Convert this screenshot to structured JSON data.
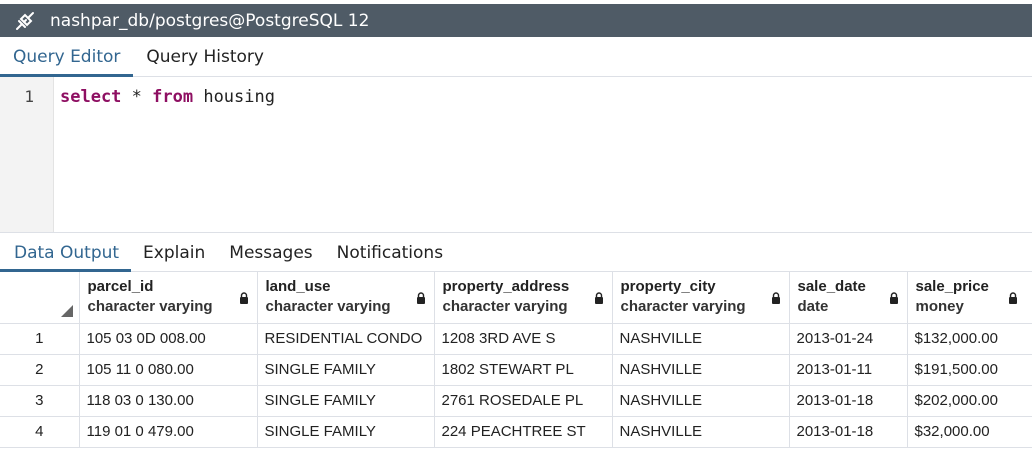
{
  "window": {
    "title": "nashpar_db/postgres@PostgreSQL 12"
  },
  "editor_tabs": [
    "Query Editor",
    "Query History"
  ],
  "editor": {
    "line_number": "1",
    "code": {
      "kw1": "select",
      "op": " * ",
      "kw2": "from",
      "rest": " housing"
    }
  },
  "output_tabs": [
    "Data Output",
    "Explain",
    "Messages",
    "Notifications"
  ],
  "table": {
    "columns": [
      {
        "name": "parcel_id",
        "type": "character varying"
      },
      {
        "name": "land_use",
        "type": "character varying"
      },
      {
        "name": "property_address",
        "type": "character varying"
      },
      {
        "name": "property_city",
        "type": "character varying"
      },
      {
        "name": "sale_date",
        "type": "date"
      },
      {
        "name": "sale_price",
        "type": "money"
      }
    ],
    "rows": [
      {
        "n": "1",
        "cells": [
          "105 03 0D 008.00",
          "RESIDENTIAL CONDO",
          "1208  3RD AVE S",
          "NASHVILLE",
          "2013-01-24",
          "$132,000.00"
        ]
      },
      {
        "n": "2",
        "cells": [
          "105 11 0 080.00",
          "SINGLE FAMILY",
          "1802  STEWART PL",
          "NASHVILLE",
          "2013-01-11",
          "$191,500.00"
        ]
      },
      {
        "n": "3",
        "cells": [
          "118 03 0 130.00",
          "SINGLE FAMILY",
          "2761  ROSEDALE PL",
          "NASHVILLE",
          "2013-01-18",
          "$202,000.00"
        ]
      },
      {
        "n": "4",
        "cells": [
          "119 01 0 479.00",
          "SINGLE FAMILY",
          "224  PEACHTREE ST",
          "NASHVILLE",
          "2013-01-18",
          "$32,000.00"
        ]
      }
    ]
  },
  "icons": {
    "connection": "plug-disconnected-icon",
    "lock": "lock-icon",
    "sort": "sort-corner-icon"
  },
  "colors": {
    "titlebar": "#4f5b66",
    "accent": "#326690",
    "keyword": "#8e0f62"
  }
}
